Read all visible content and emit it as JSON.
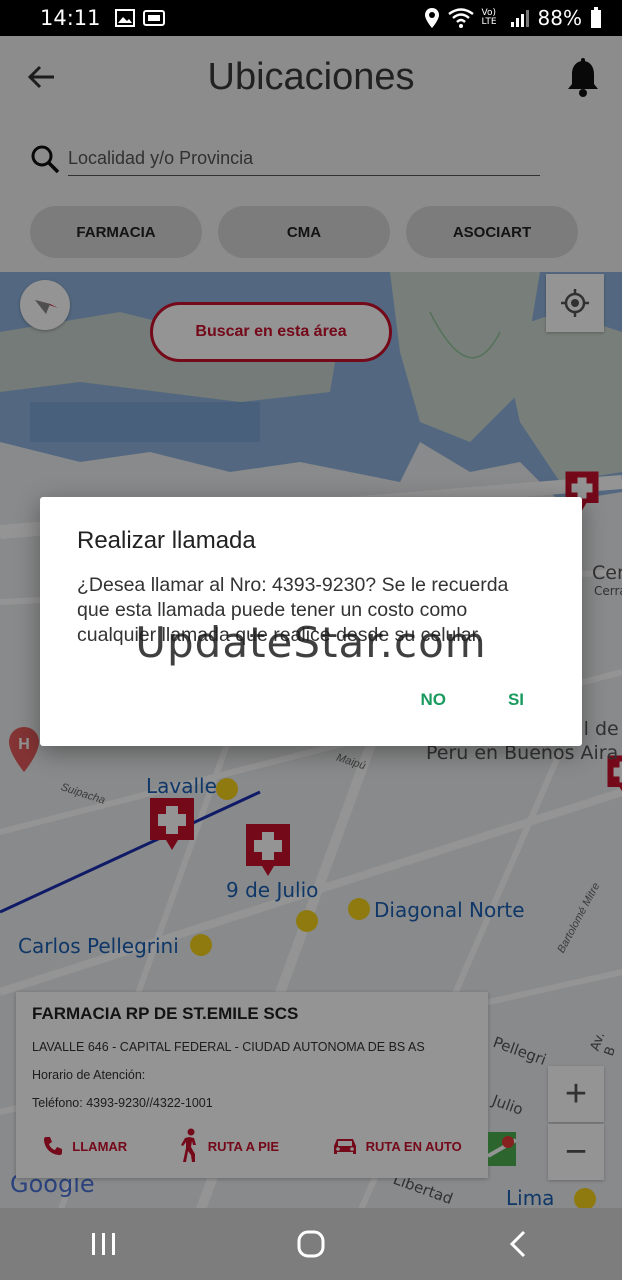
{
  "status_bar": {
    "time": "14:11",
    "network": "Vo) LTE",
    "battery": "88%",
    "icons": [
      "image-icon",
      "gallery-icon",
      "location-icon",
      "wifi-icon",
      "signal-icon",
      "battery-icon"
    ]
  },
  "header": {
    "title": "Ubicaciones",
    "back_icon": "arrow-left-icon",
    "bell_icon": "bell-icon"
  },
  "search": {
    "placeholder": "Localidad y/o Provincia",
    "icon": "search-icon"
  },
  "filters": [
    {
      "label": "FARMACIA"
    },
    {
      "label": "CMA"
    },
    {
      "label": "ASOCIART"
    }
  ],
  "map": {
    "search_area_label": "Buscar en esta área",
    "labels": {
      "lavalle": "Lavalle",
      "nueve_de_julio": "9 de Julio",
      "diagonal_norte": "Diagonal Norte",
      "carlos_pellegrini": "Carlos Pellegrini",
      "peru": "Peru en Buenos Aira",
      "del": "al de",
      "cer": "Cer",
      "cerra": "Cerra",
      "lima": "Lima",
      "julio": "Julio",
      "pellegri": "Pellegri",
      "libertad": "Libertad",
      "av_b": "Av. B"
    },
    "streets": {
      "suipacha": "Suipacha",
      "maipu": "Maipú",
      "bartolome": "Bartolomé Mitre"
    },
    "zoom_in": "+",
    "zoom_out": "−",
    "google": "Google"
  },
  "card": {
    "title": "FARMACIA RP DE ST.EMILE SCS",
    "address": "LAVALLE 646 - CAPITAL FEDERAL - CIUDAD AUTONOMA DE BS AS",
    "hours": "Horario de Atención:",
    "phone": "Teléfono: 4393-9230//4322-1001",
    "actions": {
      "call": "LLAMAR",
      "walk": "RUTA A PIE",
      "car": "RUTA EN AUTO"
    }
  },
  "dialog": {
    "title": "Realizar llamada",
    "message": "¿Desea llamar al Nro: 4393-9230? Se le recuerda que esta llamada puede tener un costo como cualquier llamada que realice desde su celular.",
    "no": "NO",
    "yes": "SI"
  },
  "watermark": "UpdateStar.com",
  "colors": {
    "accent": "#c8102e",
    "dialog_button": "#1b9a60",
    "map_label": "#1a5fb4"
  }
}
